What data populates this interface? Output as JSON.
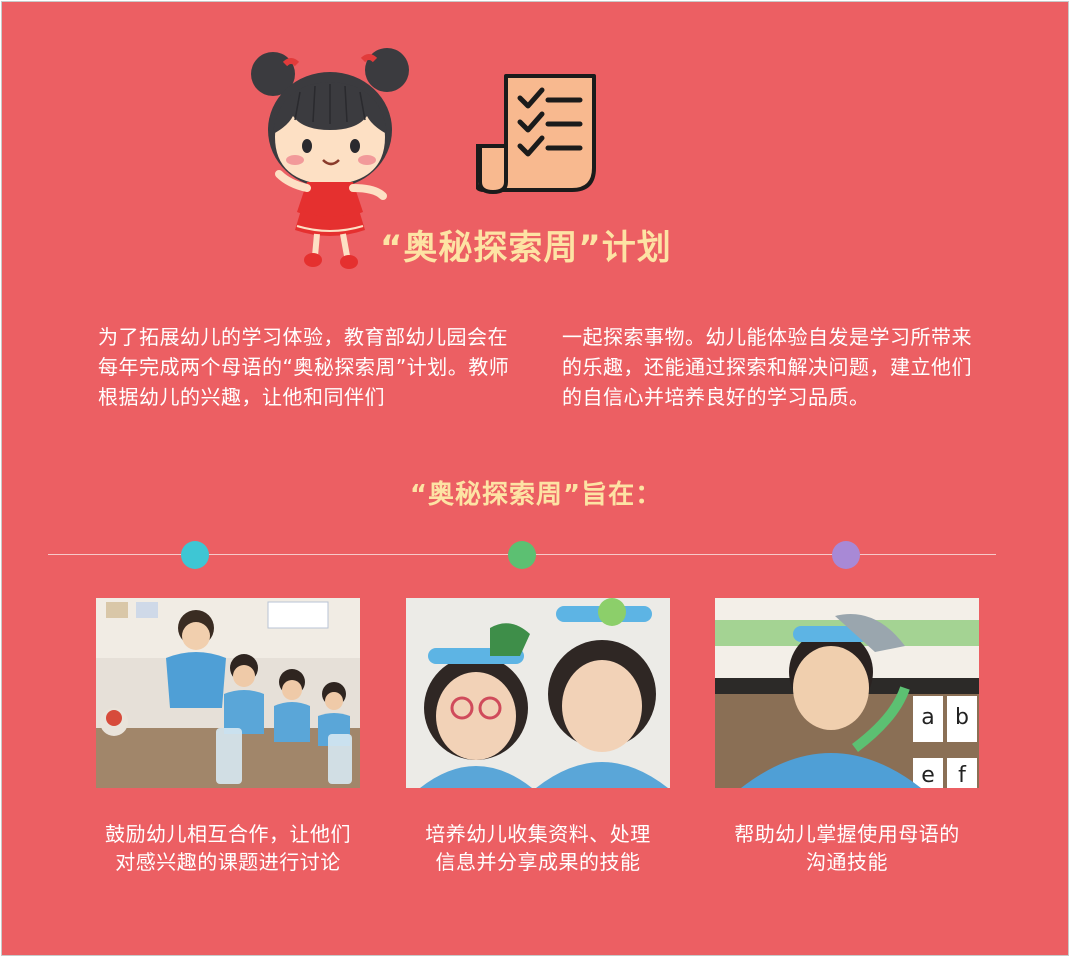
{
  "title": "“奥秘探索周”计划",
  "intro": {
    "left_text": "为了拓展幼儿的学习体验，教育部幼儿园会在每年完成两个母语的“奥秘探索周”计划。教师根据幼儿的兴趣，让他和同伴们",
    "right_text": "一起探索事物。幼儿能体验自发是学习所带来的乐趣，还能通过探索和解决问题，建立他们的自信心并培养良好的学习品质。"
  },
  "subtitle": "“奥秘探索周”旨在：",
  "colors": {
    "background": "#ec5f63",
    "title": "#fde3a4",
    "dot_1": "#3ec6d4",
    "dot_2": "#5cc072",
    "dot_3": "#a889d6"
  },
  "goals": [
    {
      "icon": "photo-children-cooperating",
      "caption_line1": "鼓励幼儿相互合作，让他们",
      "caption_line2": "对感兴趣的课题进行讨论"
    },
    {
      "icon": "photo-children-with-headbands",
      "caption_line1": "培养幼儿收集资料、处理",
      "caption_line2": "信息并分享成果的技能"
    },
    {
      "icon": "photo-boy-with-headband",
      "caption_line1": "帮助幼儿掌握使用母语的",
      "caption_line2": "沟通技能"
    }
  ],
  "photo_letters": [
    "a",
    "b",
    "e",
    "f"
  ]
}
